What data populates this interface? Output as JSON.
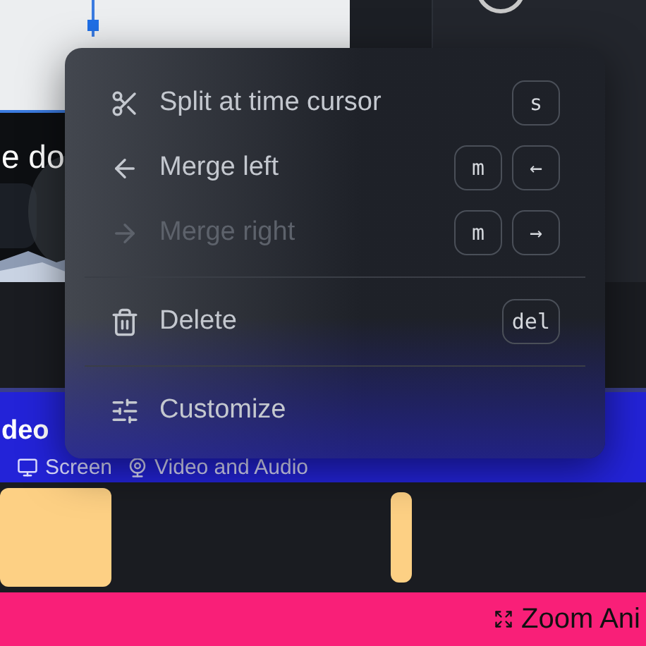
{
  "preview": {
    "caption": "e do"
  },
  "menu": {
    "items": [
      {
        "kind": "action",
        "label": "Split at time cursor",
        "keys": [
          "s"
        ],
        "disabled": false
      },
      {
        "kind": "action",
        "label": "Merge left",
        "keys": [
          "m",
          "←"
        ],
        "disabled": false
      },
      {
        "kind": "action",
        "label": "Merge right",
        "keys": [
          "m",
          "→"
        ],
        "disabled": true
      },
      {
        "kind": "divider"
      },
      {
        "kind": "action",
        "label": "Delete",
        "keys": [
          "del"
        ],
        "disabled": false
      },
      {
        "kind": "divider"
      },
      {
        "kind": "action",
        "label": "Customize",
        "disabled": false
      }
    ]
  },
  "video_track": {
    "title": "deo",
    "tags": [
      {
        "label": "Screen"
      },
      {
        "label": "Video and Audio"
      }
    ]
  },
  "zoom_track": {
    "label": "Zoom Ani"
  }
}
